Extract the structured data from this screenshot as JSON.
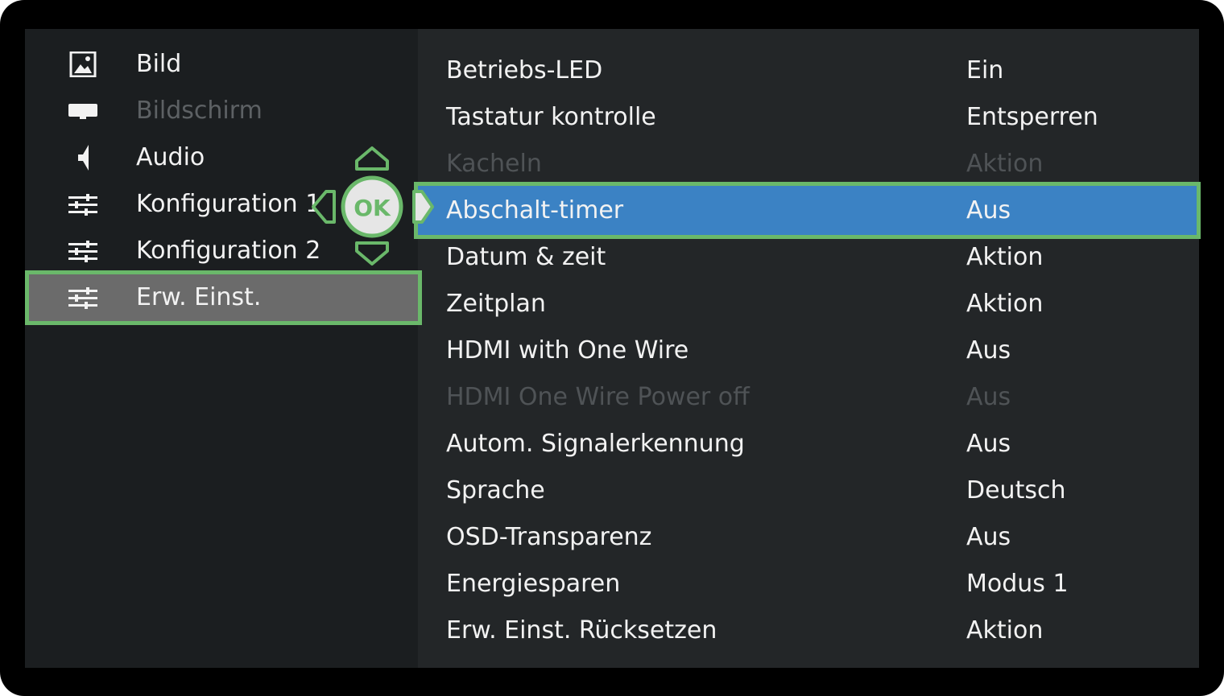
{
  "sidebar": {
    "items": [
      {
        "label": "Bild",
        "icon": "picture-icon",
        "state": "normal"
      },
      {
        "label": "Bildschirm",
        "icon": "screen-icon",
        "state": "disabled"
      },
      {
        "label": "Audio",
        "icon": "speaker-icon",
        "state": "normal"
      },
      {
        "label": "Konfiguration 1",
        "icon": "sliders-icon",
        "state": "normal"
      },
      {
        "label": "Konfiguration 2",
        "icon": "sliders-icon",
        "state": "normal"
      },
      {
        "label": "Erw. Einst.",
        "icon": "sliders-icon",
        "state": "active"
      }
    ]
  },
  "settings": {
    "rows": [
      {
        "name": "Betriebs-LED",
        "value": "Ein",
        "state": "normal"
      },
      {
        "name": "Tastatur kontrolle",
        "value": "Entsperren",
        "state": "normal"
      },
      {
        "name": "Kacheln",
        "value": "Aktion",
        "state": "disabled"
      },
      {
        "name": "Abschalt-timer",
        "value": "Aus",
        "state": "selected"
      },
      {
        "name": "Datum & zeit",
        "value": "Aktion",
        "state": "normal"
      },
      {
        "name": "Zeitplan",
        "value": "Aktion",
        "state": "normal"
      },
      {
        "name": "HDMI with One Wire",
        "value": "Aus",
        "state": "normal"
      },
      {
        "name": "HDMI One Wire Power off",
        "value": "Aus",
        "state": "disabled"
      },
      {
        "name": "Autom. Signalerkennung",
        "value": "Aus",
        "state": "normal"
      },
      {
        "name": "Sprache",
        "value": "Deutsch",
        "state": "normal"
      },
      {
        "name": "OSD-Transparenz",
        "value": "Aus",
        "state": "normal"
      },
      {
        "name": "Energiesparen",
        "value": "Modus 1",
        "state": "normal"
      },
      {
        "name": "Erw. Einst. Rücksetzen",
        "value": "Aktion",
        "state": "normal"
      }
    ]
  },
  "remote_hint": {
    "ok_label": "OK",
    "icons": [
      "up-arrow-icon",
      "down-arrow-icon",
      "left-arrow-icon",
      "right-arrow-icon",
      "ok-button-icon"
    ]
  },
  "colors": {
    "highlight_border": "#6ab86a",
    "selected_row": "#3b82c4",
    "active_category": "#6b6b6b",
    "text": "#f2f2f2",
    "disabled_text": "#4f5356"
  }
}
